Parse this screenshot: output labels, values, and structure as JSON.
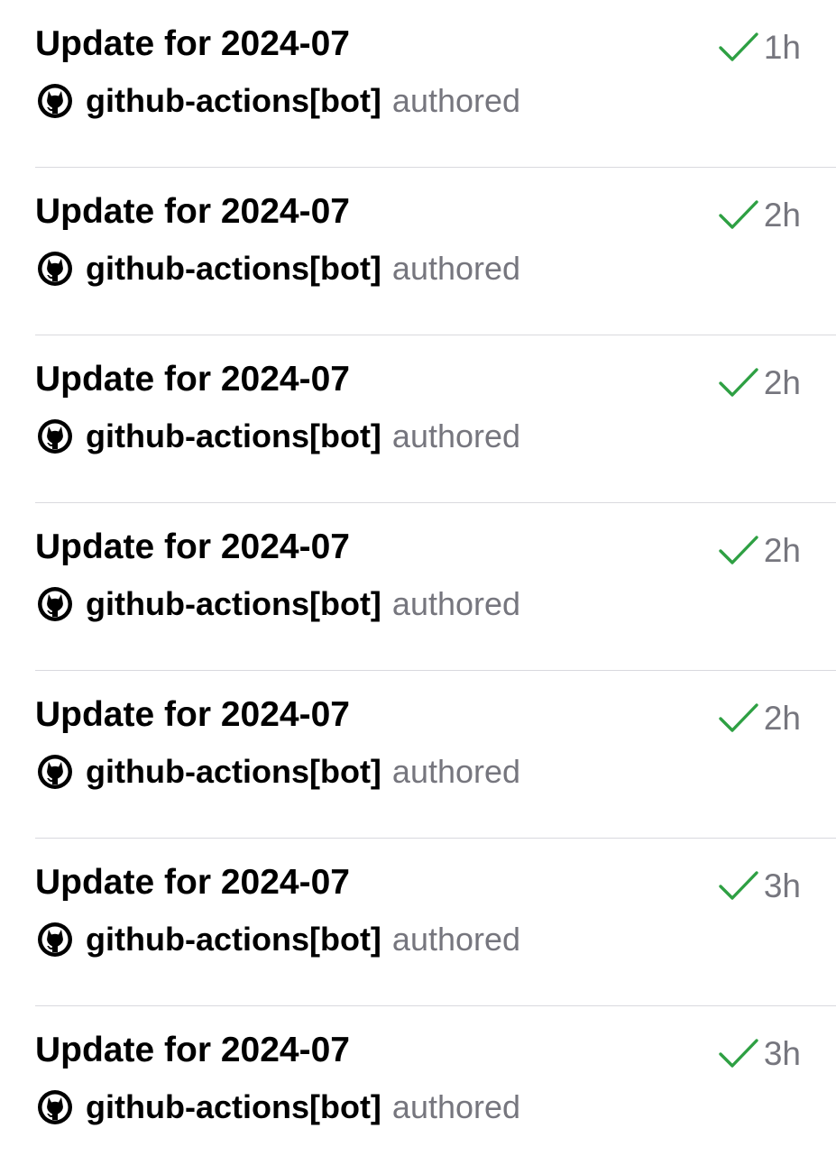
{
  "colors": {
    "success": "#2ea043",
    "secondary_text": "#76767e",
    "divider": "#d9d9de"
  },
  "commits": [
    {
      "title": "Update for 2024-07",
      "author": "github-actions[bot]",
      "action": "authored",
      "time": "1h",
      "status_icon": "check-icon",
      "avatar_icon": "github-mark-icon"
    },
    {
      "title": "Update for 2024-07",
      "author": "github-actions[bot]",
      "action": "authored",
      "time": "2h",
      "status_icon": "check-icon",
      "avatar_icon": "github-mark-icon"
    },
    {
      "title": "Update for 2024-07",
      "author": "github-actions[bot]",
      "action": "authored",
      "time": "2h",
      "status_icon": "check-icon",
      "avatar_icon": "github-mark-icon"
    },
    {
      "title": "Update for 2024-07",
      "author": "github-actions[bot]",
      "action": "authored",
      "time": "2h",
      "status_icon": "check-icon",
      "avatar_icon": "github-mark-icon"
    },
    {
      "title": "Update for 2024-07",
      "author": "github-actions[bot]",
      "action": "authored",
      "time": "2h",
      "status_icon": "check-icon",
      "avatar_icon": "github-mark-icon"
    },
    {
      "title": "Update for 2024-07",
      "author": "github-actions[bot]",
      "action": "authored",
      "time": "3h",
      "status_icon": "check-icon",
      "avatar_icon": "github-mark-icon"
    },
    {
      "title": "Update for 2024-07",
      "author": "github-actions[bot]",
      "action": "authored",
      "time": "3h",
      "status_icon": "check-icon",
      "avatar_icon": "github-mark-icon"
    }
  ]
}
